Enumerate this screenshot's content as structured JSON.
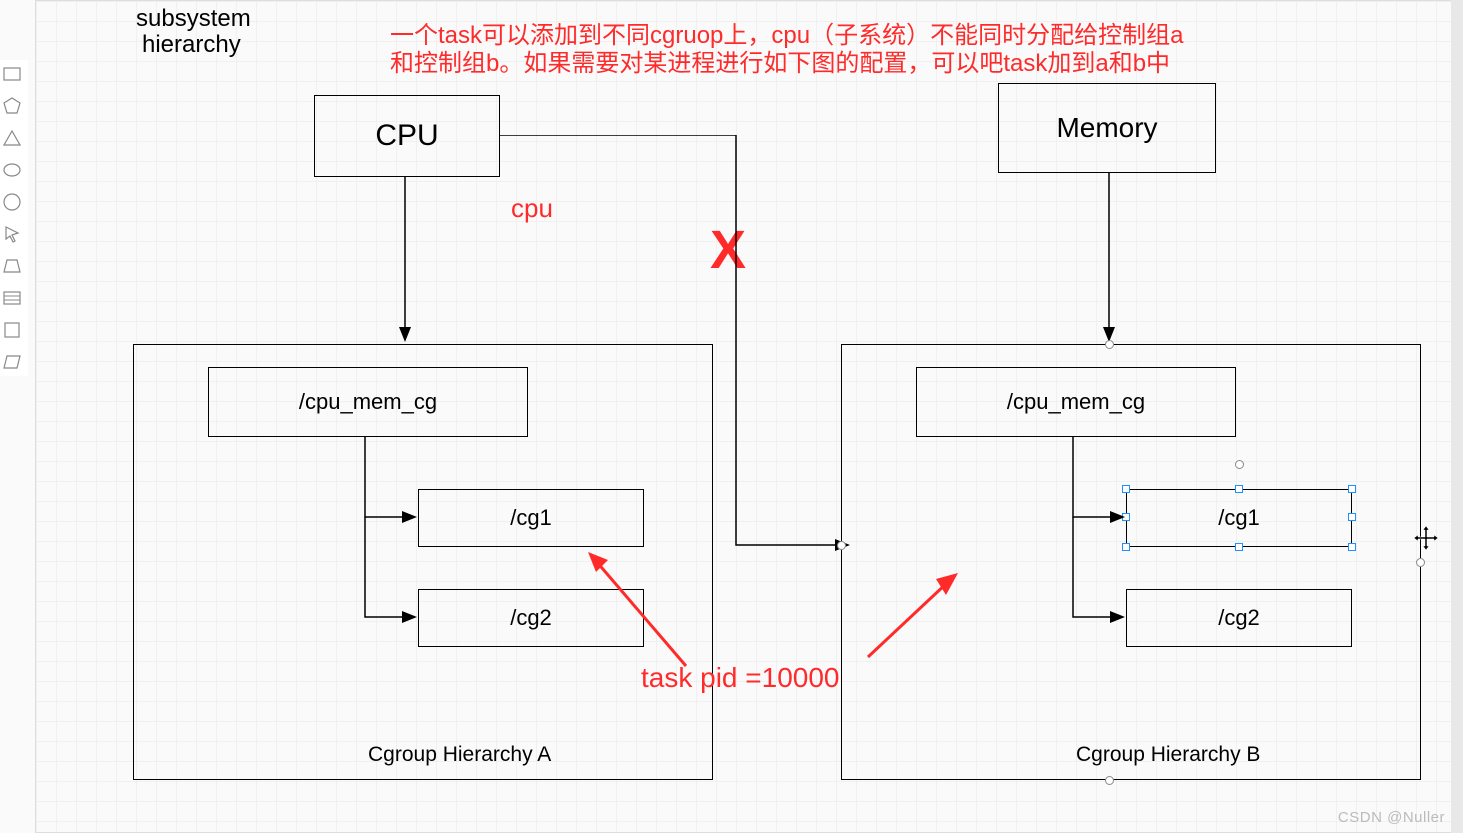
{
  "header": {
    "subsystem": "subsystem",
    "hierarchy": "hierarchy"
  },
  "annotations": {
    "line1": "一个task可以添加到不同cgruop上，cpu（子系统）不能同时分配给控制组a",
    "line2": "和控制组b。如果需要对某进程进行如下图的配置，可以吧task加到a和b中",
    "cpu": "cpu",
    "x": "X",
    "task": "task pid =10000"
  },
  "nodes": {
    "cpu": "CPU",
    "memory": "Memory",
    "cpu_mem_cg": "/cpu_mem_cg",
    "cg1": "/cg1",
    "cg2": "/cg2",
    "hierA": "Cgroup Hierarchy A",
    "hierB": "Cgroup Hierarchy B"
  },
  "icons": {
    "move": "move-icon"
  },
  "watermark": "CSDN @Nuller"
}
